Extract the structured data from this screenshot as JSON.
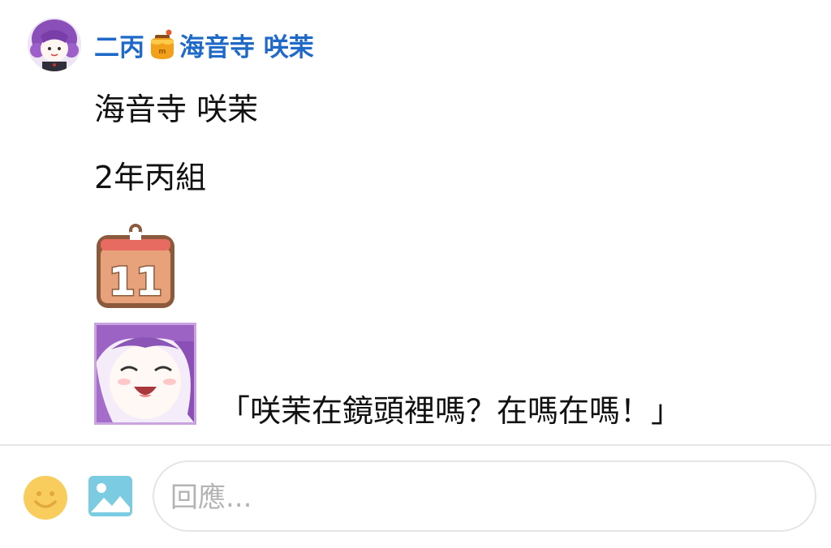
{
  "post": {
    "author_prefix": "二丙",
    "author_badge_icon": "honey-pot-icon",
    "author_name": "海音寺 咲茉",
    "author_color": "#1f69c9",
    "lines": [
      "海音寺 咲茉",
      "2年丙組"
    ],
    "calendar_sticker": {
      "icon": "calendar-icon",
      "day": "11"
    },
    "quote_sticker_icon": "laughing-girl-sticker",
    "quote": "「咲茉在鏡頭裡嗎？在嗎在嗎！」"
  },
  "composer": {
    "emoji_icon": "smiley-icon",
    "image_icon": "image-icon",
    "placeholder": "回應..."
  }
}
